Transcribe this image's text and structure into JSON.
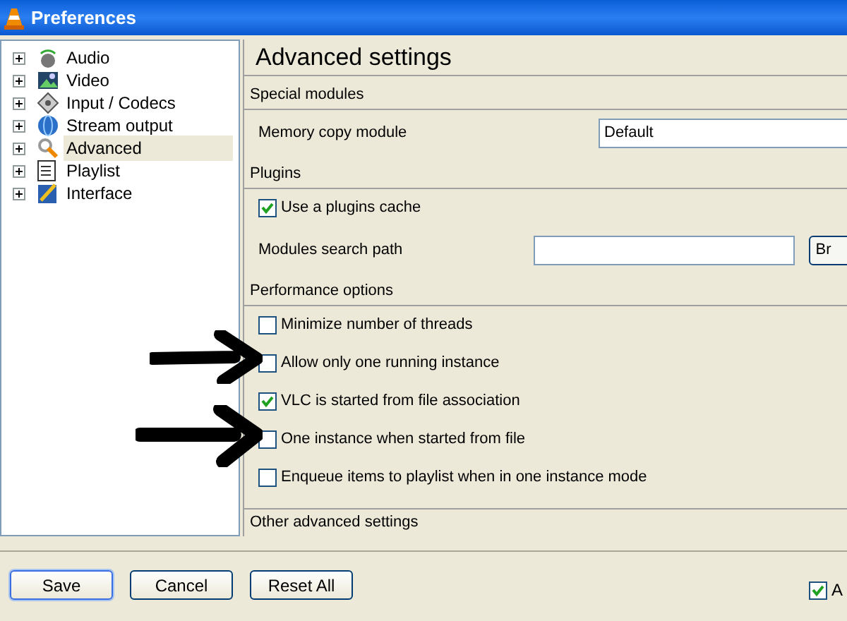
{
  "window": {
    "title": "Preferences"
  },
  "tree": [
    {
      "label": "Audio",
      "expanded": false,
      "selected": false
    },
    {
      "label": "Video",
      "expanded": false,
      "selected": false
    },
    {
      "label": "Input / Codecs",
      "expanded": false,
      "selected": false
    },
    {
      "label": "Stream output",
      "expanded": false,
      "selected": false
    },
    {
      "label": "Advanced",
      "expanded": false,
      "selected": true
    },
    {
      "label": "Playlist",
      "expanded": false,
      "selected": false
    },
    {
      "label": "Interface",
      "expanded": false,
      "selected": false
    }
  ],
  "panel": {
    "title": "Advanced settings",
    "sections": [
      {
        "title": "Special modules",
        "options": [
          {
            "kind": "dropdown",
            "label": "Memory copy module",
            "value": "Default"
          }
        ]
      },
      {
        "title": "Plugins",
        "options": [
          {
            "kind": "checkbox",
            "label": "Use a plugins cache",
            "checked": true
          },
          {
            "kind": "path",
            "label": "Modules search path",
            "button": "Br"
          }
        ]
      },
      {
        "title": "Performance options",
        "options": [
          {
            "kind": "checkbox",
            "label": "Minimize number of threads",
            "checked": false
          },
          {
            "kind": "checkbox",
            "label": "Allow only one running instance",
            "checked": false
          },
          {
            "kind": "checkbox",
            "label": "VLC is started from file association",
            "checked": true
          },
          {
            "kind": "checkbox",
            "label": "One instance when started from file",
            "checked": false
          },
          {
            "kind": "checkbox",
            "label": "Enqueue items to playlist when in one instance mode",
            "checked": false
          }
        ]
      },
      {
        "title": "Other advanced settings"
      }
    ]
  },
  "buttons": [
    {
      "label": "Save",
      "default": true
    },
    {
      "label": "Cancel",
      "default": false
    },
    {
      "label": "Reset All",
      "default": false
    }
  ],
  "footer_checkbox": {
    "label": "A",
    "checked": true
  }
}
